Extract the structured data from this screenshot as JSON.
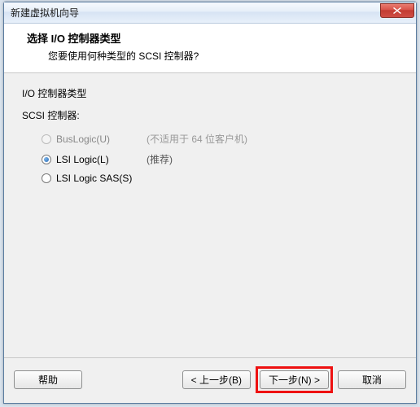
{
  "window": {
    "title": "新建虚拟机向导"
  },
  "header": {
    "title": "选择 I/O 控制器类型",
    "subtitle": "您要使用何种类型的 SCSI 控制器?"
  },
  "content": {
    "section_label": "I/O 控制器类型",
    "scsi_label": "SCSI 控制器:",
    "options": [
      {
        "label": "BusLogic(U)",
        "hint": "(不适用于 64 位客户机)",
        "selected": false,
        "disabled": true
      },
      {
        "label": "LSI Logic(L)",
        "hint": "(推荐)",
        "selected": true,
        "disabled": false
      },
      {
        "label": "LSI Logic SAS(S)",
        "hint": "",
        "selected": false,
        "disabled": false
      }
    ]
  },
  "footer": {
    "help": "帮助",
    "back": "< 上一步(B)",
    "next": "下一步(N) >",
    "cancel": "取消"
  }
}
